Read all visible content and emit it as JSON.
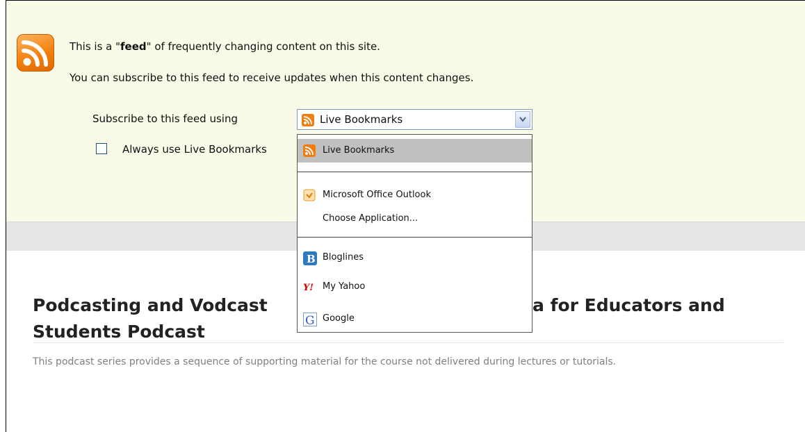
{
  "feed_notice": {
    "line1_pre": "This is a \"",
    "line1_bold": "feed",
    "line1_post": "\" of frequently changing content on this site.",
    "line2": "You can subscribe to this feed to receive updates when this content changes."
  },
  "subscribe": {
    "label": "Subscribe to this feed using",
    "selected_value": "Live Bookmarks",
    "always_use_label": "Always use Live Bookmarks"
  },
  "dropdown": {
    "groups": [
      [
        {
          "label": "Live Bookmarks",
          "icon": "rss-icon",
          "selected": true
        }
      ],
      [
        {
          "label": "Microsoft Office Outlook",
          "icon": "outlook-icon"
        },
        {
          "label": "Choose Application...",
          "icon": ""
        }
      ],
      [
        {
          "label": "Bloglines",
          "icon": "bloglines-icon"
        },
        {
          "label": "My Yahoo",
          "icon": "yahoo-icon"
        },
        {
          "label": "Google",
          "icon": "google-icon"
        }
      ]
    ]
  },
  "podcast": {
    "title_left": "Podcasting and Vodcast",
    "title_right": "a for Educators and",
    "title_line2": "Students Podcast",
    "description": "This podcast series provides a sequence of supporting material for the course not delivered during lectures or tutorials."
  },
  "colors": {
    "header_bg": "#fafae8",
    "rss_orange": "#f27d0c",
    "band_gray": "#e6e6e6"
  }
}
